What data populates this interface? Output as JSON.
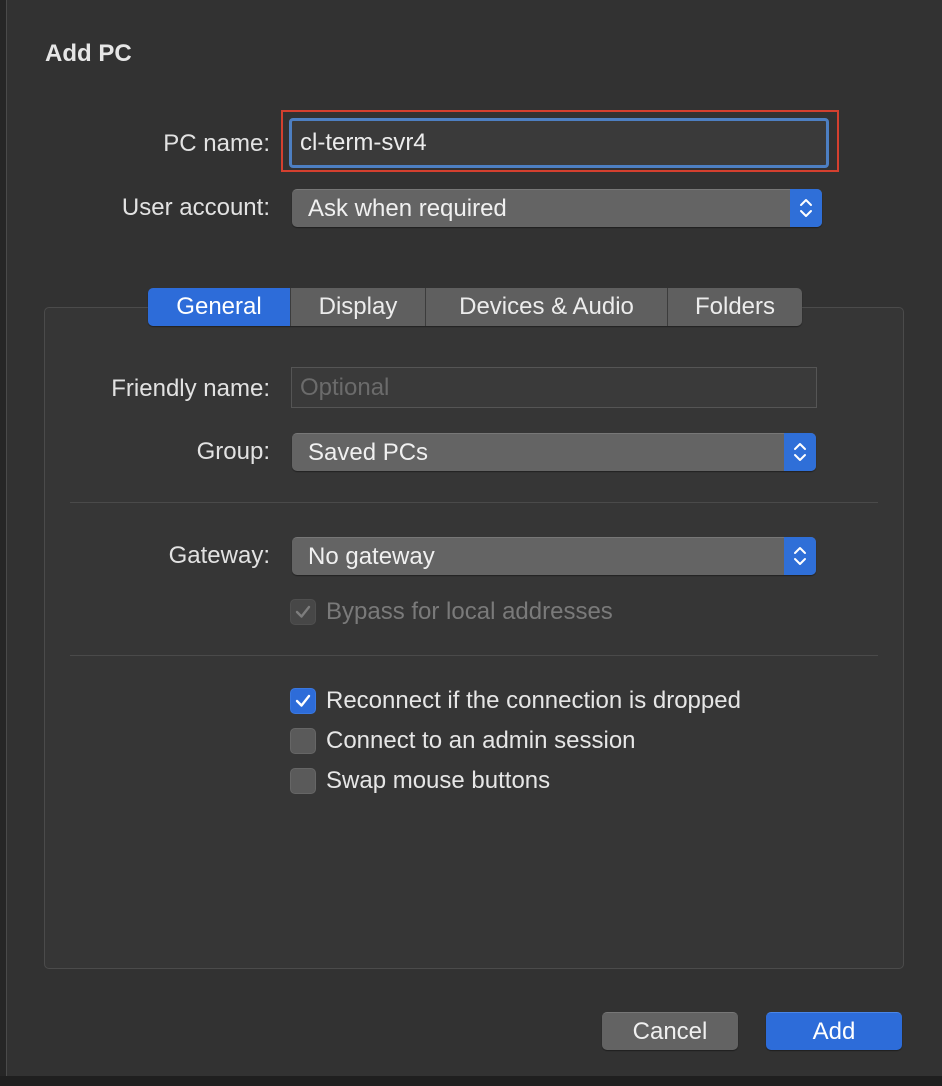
{
  "window": {
    "title": "Add PC"
  },
  "form": {
    "pc_name_label": "PC name:",
    "pc_name_value": "cl-term-svr4",
    "user_account_label": "User account:",
    "user_account_value": "Ask when required"
  },
  "tabs": [
    {
      "label": "General",
      "active": true
    },
    {
      "label": "Display",
      "active": false
    },
    {
      "label": "Devices & Audio",
      "active": false
    },
    {
      "label": "Folders",
      "active": false
    }
  ],
  "general": {
    "friendly_name_label": "Friendly name:",
    "friendly_name_placeholder": "Optional",
    "friendly_name_value": "",
    "group_label": "Group:",
    "group_value": "Saved PCs",
    "gateway_label": "Gateway:",
    "gateway_value": "No gateway",
    "bypass_label": "Bypass for local addresses",
    "bypass_checked": true,
    "bypass_disabled": true,
    "options": [
      {
        "label": "Reconnect if the connection is dropped",
        "checked": true
      },
      {
        "label": "Connect to an admin session",
        "checked": false
      },
      {
        "label": "Swap mouse buttons",
        "checked": false
      }
    ]
  },
  "buttons": {
    "cancel_label": "Cancel",
    "add_label": "Add"
  },
  "colors": {
    "accent": "#2d6cd9",
    "highlight": "#d4402f",
    "background": "#323232"
  }
}
